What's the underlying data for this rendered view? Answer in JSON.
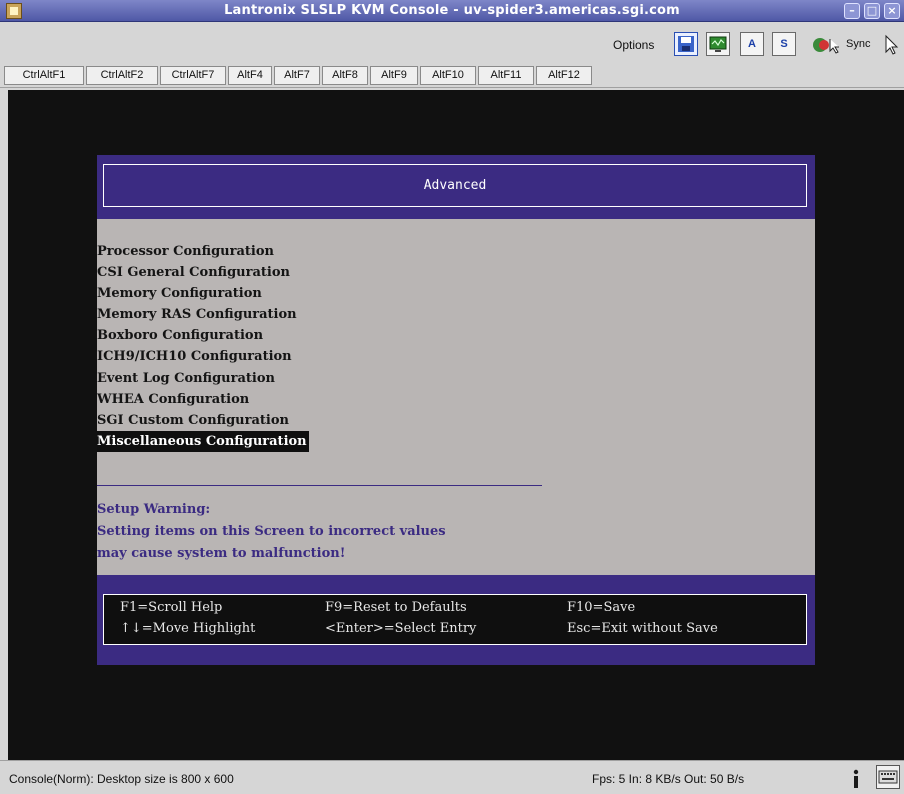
{
  "window": {
    "title": "Lantronix SLSLP KVM Console - uv-spider3.americas.sgi.com"
  },
  "toolbar": {
    "options_label": "Options",
    "buttons": [
      {
        "name": "save",
        "icon": "save-icon",
        "label": ""
      },
      {
        "name": "monitor",
        "icon": "monitor-icon",
        "label": ""
      },
      {
        "name": "auto-adjust",
        "icon": "auto-adjust-icon",
        "label": "A"
      },
      {
        "name": "scale",
        "icon": "scale-icon",
        "label": "S"
      }
    ],
    "sync_label": "Sync"
  },
  "hotkeys": [
    "CtrlAltF1",
    "CtrlAltF2",
    "CtrlAltF7",
    "AltF4",
    "AltF7",
    "AltF8",
    "AltF9",
    "AltF10",
    "AltF11",
    "AltF12"
  ],
  "bios": {
    "header_title": "Advanced",
    "menu_items": [
      "Processor Configuration",
      "CSI General Configuration",
      "Memory Configuration",
      "Memory RAS Configuration",
      "Boxboro Configuration",
      "ICH9/ICH10 Configuration",
      "Event Log Configuration",
      "WHEA Configuration",
      "SGI Custom Configuration",
      "Miscellaneous Configuration"
    ],
    "selected_index": 9,
    "warning": {
      "title": "Setup Warning:",
      "line1": "Setting items on this Screen to incorrect values",
      "line2": "may cause system to malfunction!"
    },
    "footer": {
      "f1": "F1=Scroll Help",
      "move": "↑↓=Move Highlight",
      "f9": "F9=Reset to Defaults",
      "enter": "<Enter>=Select Entry",
      "f10": "F10=Save",
      "esc": "Esc=Exit without Save"
    }
  },
  "status": {
    "left": "Console(Norm): Desktop size is 800 x 600",
    "right": "Fps: 5 In: 8 KB/s Out: 50 B/s"
  },
  "colors": {
    "bios_blue": "#3b2b82",
    "bios_gray": "#b9b5b4",
    "titlebar": "#5a63b0"
  }
}
